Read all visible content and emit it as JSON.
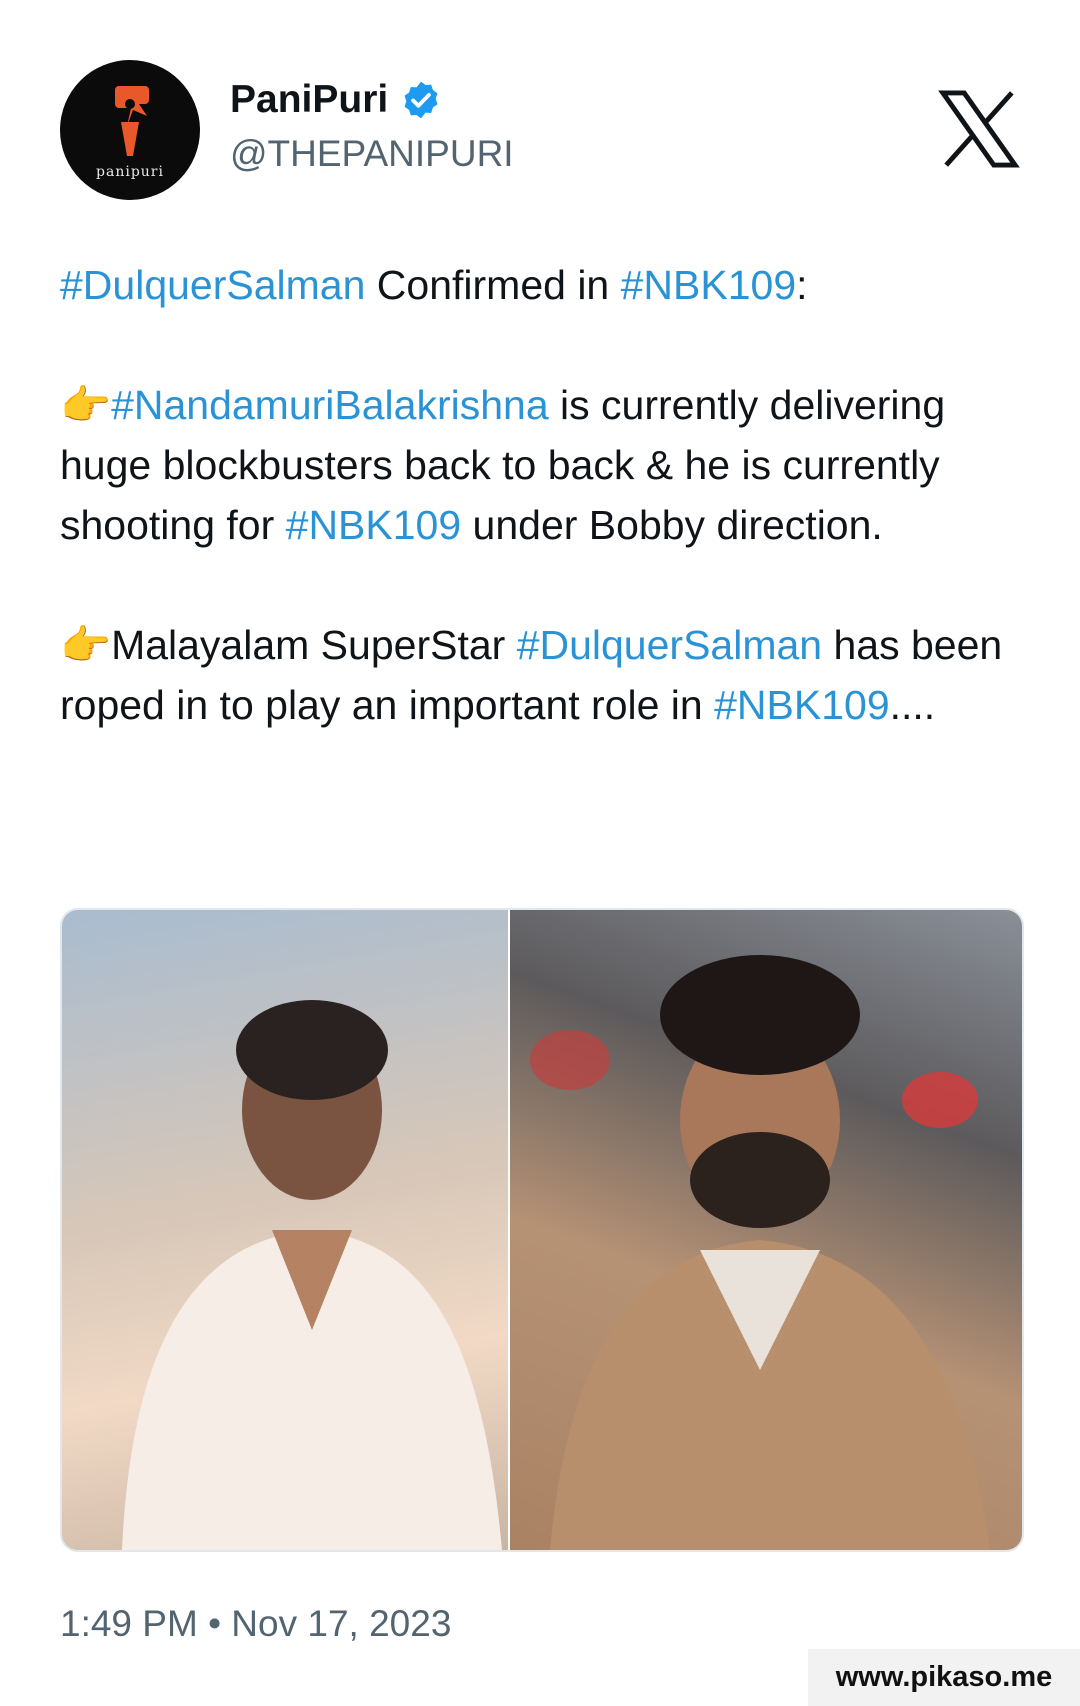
{
  "author": {
    "display_name": "PaniPuri",
    "handle": "@THEPANIPURI",
    "avatar_text": "panipuri",
    "verified": true
  },
  "brand_icon": "x-logo-icon",
  "tweet": {
    "p1": {
      "h1": "#DulquerSalman",
      "t1": " Confirmed in ",
      "h2": "#NBK109",
      "t2": ":"
    },
    "p2": {
      "emoji": "👉",
      "h1": "#NandamuriBalakrishna",
      "t1": " is currently delivering huge blockbusters back to back & he is currently shooting for ",
      "h2": "#NBK109",
      "t2": " under Bobby direction."
    },
    "p3": {
      "emoji": "👉",
      "t1": "Malayalam SuperStar ",
      "h1": "#DulquerSalman",
      "t2": " has been roped in to play an important role in ",
      "h2": "#NBK109",
      "t3": "...."
    }
  },
  "media": [
    {
      "name": "photo-nandamuri-balakrishna"
    },
    {
      "name": "photo-dulquer-salman"
    }
  ],
  "timestamp": "1:49 PM • Nov 17, 2023",
  "watermark": "www.pikaso.me",
  "colors": {
    "hashtag": "#2a93d5",
    "verified": "#1d9bf0",
    "text": "#0f1419",
    "muted": "#536471"
  }
}
